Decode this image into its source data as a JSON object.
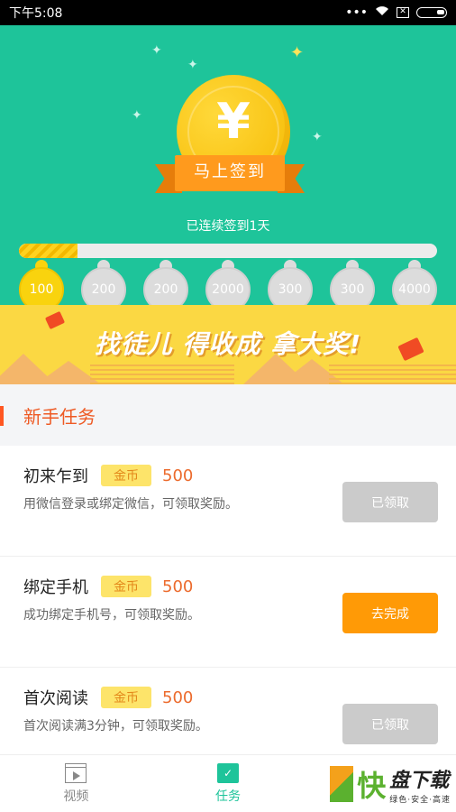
{
  "status_bar": {
    "time": "下午5:08",
    "dots": "•••",
    "wifi": "wifi-icon",
    "x": "✕"
  },
  "hero": {
    "coin_symbol": "¥",
    "checkin_button": "马上签到",
    "streak_text": "已连续签到1天",
    "progress_fraction": 0.14,
    "rewards": [
      {
        "value": "100",
        "claimed": true
      },
      {
        "value": "200",
        "claimed": false
      },
      {
        "value": "200",
        "claimed": false
      },
      {
        "value": "2000",
        "claimed": false
      },
      {
        "value": "300",
        "claimed": false
      },
      {
        "value": "300",
        "claimed": false
      },
      {
        "value": "4000",
        "claimed": false
      }
    ]
  },
  "banner": {
    "text": "找徒儿 得收成 拿大奖!"
  },
  "section": {
    "title": "新手任务"
  },
  "tasks": [
    {
      "title": "初来乍到",
      "tag": "金币",
      "amount": "500",
      "desc": "用微信登录或绑定微信，可领取奖励。",
      "button": "已领取",
      "status": "claimed"
    },
    {
      "title": "绑定手机",
      "tag": "金币",
      "amount": "500",
      "desc": "成功绑定手机号，可领取奖励。",
      "button": "去完成",
      "status": "todo"
    },
    {
      "title": "首次阅读",
      "tag": "金币",
      "amount": "500",
      "desc": "首次阅读满3分钟，可领取奖励。",
      "button": "已领取",
      "status": "claimed"
    }
  ],
  "tabbar": {
    "tabs": [
      {
        "label": "视频",
        "icon": "video-icon",
        "active": false
      },
      {
        "label": "任务",
        "icon": "task-calendar-icon",
        "active": true
      }
    ]
  },
  "watermark": {
    "kuai": "快",
    "name": "盘下载",
    "slogan": "绿色·安全·高速"
  },
  "colors": {
    "hero_bg": "#1ec49a",
    "accent_orange": "#ff9a06",
    "title_orange": "#ee5a24",
    "coin_yellow": "#f9d30e"
  }
}
